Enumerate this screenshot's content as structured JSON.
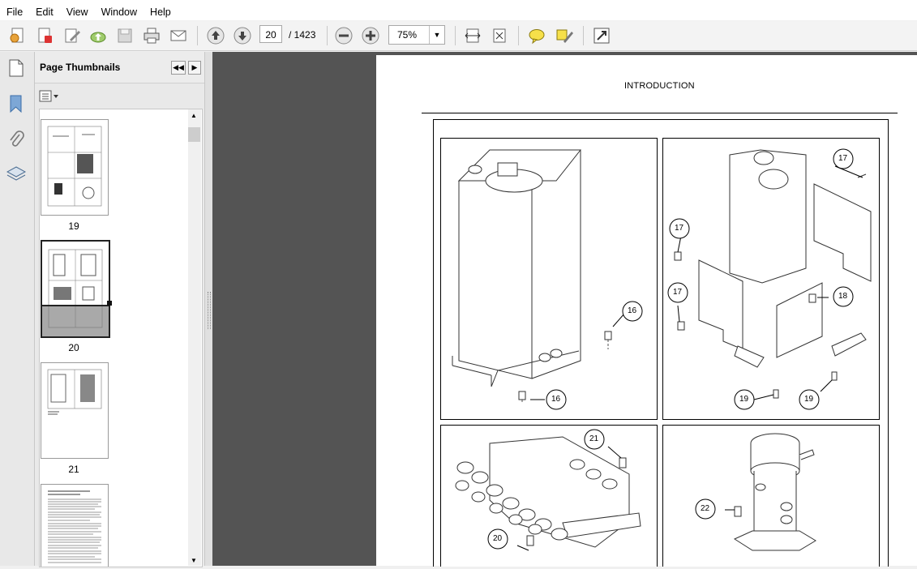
{
  "menu": [
    "File",
    "Edit",
    "View",
    "Window",
    "Help"
  ],
  "toolbar": {
    "current_page": "20",
    "page_total": "/  1423",
    "zoom": "75%"
  },
  "panel": {
    "title": "Page Thumbnails",
    "thumbnails": [
      {
        "label": "19"
      },
      {
        "label": "20"
      },
      {
        "label": "21"
      }
    ]
  },
  "document": {
    "header": "INTRODUCTION",
    "callouts": {
      "c16a": "16",
      "c16b": "16",
      "c17a": "17",
      "c17b": "17",
      "c17c": "17",
      "c18": "18",
      "c19a": "19",
      "c19b": "19",
      "c20": "20",
      "c21": "21",
      "c22": "22"
    }
  },
  "icons": [
    "create-pdf-icon",
    "edit-pdf-icon",
    "sign-icon",
    "upload-icon",
    "save-icon",
    "print-icon",
    "email-icon",
    "page-up-icon",
    "page-down-icon",
    "zoom-out-icon",
    "zoom-in-icon",
    "fit-width-icon",
    "fit-page-icon",
    "comment-icon",
    "highlight-icon",
    "fullscreen-icon"
  ]
}
